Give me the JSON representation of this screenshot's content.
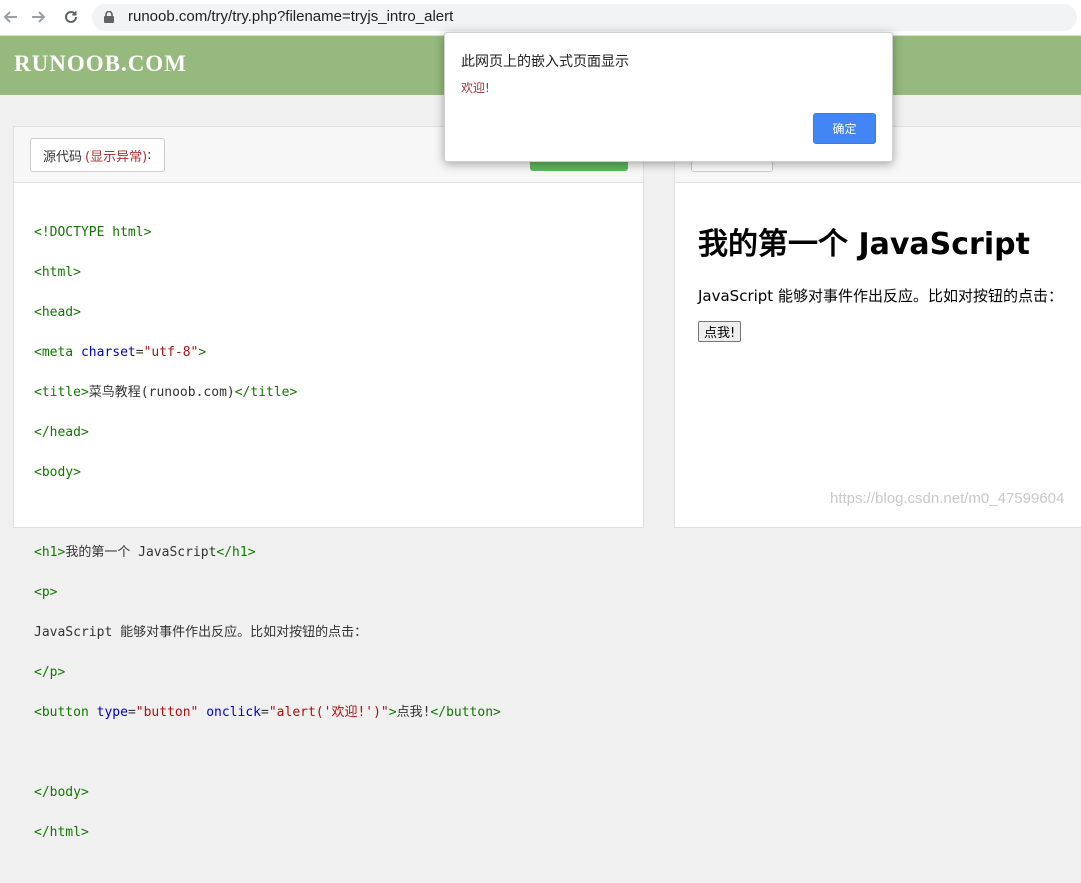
{
  "browser": {
    "url": "runoob.com/try/try.php?filename=tryjs_intro_alert",
    "back_icon": "back-arrow-icon",
    "forward_icon": "forward-arrow-icon",
    "reload_icon": "reload-icon"
  },
  "site": {
    "logo": "RUNOOB.COM",
    "header_color": "#96ba7d"
  },
  "left_panel": {
    "source_label": "源代码",
    "source_hint": "(显示异常)",
    "source_suffix": ":"
  },
  "code": {
    "l1": "<!DOCTYPE html>",
    "l2": "<html>",
    "l3": "<head>",
    "l4_open": "<meta ",
    "l4_attr": "charset",
    "l4_eq": "=",
    "l4_val": "\"utf-8\"",
    "l4_close": ">",
    "l5_open": "<title>",
    "l5_text": "菜鸟教程(runoob.com)",
    "l5_close": "</title>",
    "l6": "</head>",
    "l7": "<body>",
    "l8_open": "<h1>",
    "l8_text": "我的第一个 JavaScript",
    "l8_close": "</h1>",
    "l9": "<p>",
    "l10": "JavaScript 能够对事件作出反应。比如对按钮的点击：",
    "l11": "</p>",
    "l12_open": "<button ",
    "l12_attr1": "type",
    "l12_eq1": "=",
    "l12_val1": "\"button\"",
    "l12_sp": " ",
    "l12_attr2": "onclick",
    "l12_eq2": "=",
    "l12_val2": "\"alert('欢迎!')\"",
    "l12_gt": ">",
    "l12_text": "点我!",
    "l12_close": "</button>",
    "l13": "</body>",
    "l14": "</html>"
  },
  "preview": {
    "heading": "我的第一个 JavaScript",
    "paragraph": "JavaScript 能够对事件作出反应。比如对按钮的点击：",
    "button_label": "点我!"
  },
  "dialog": {
    "title": "此网页上的嵌入式页面显示",
    "message": "欢迎!",
    "ok_label": "确定",
    "ok_color": "#4285f4"
  },
  "watermark": "https://blog.csdn.net/m0_47599604"
}
